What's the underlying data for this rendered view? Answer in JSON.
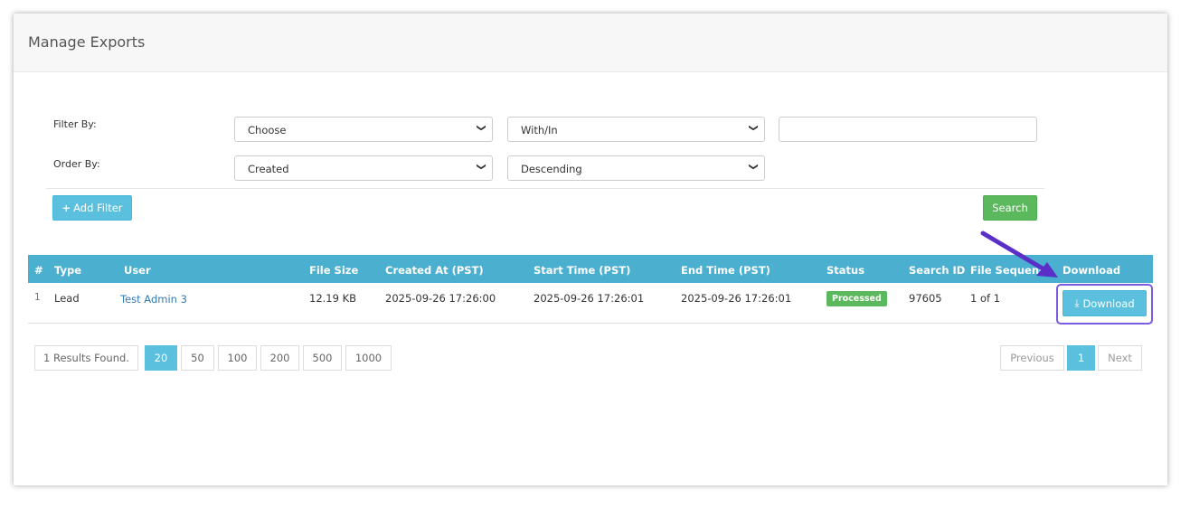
{
  "page": {
    "title": "Manage Exports"
  },
  "filters": {
    "filter_by_label": "Filter By:",
    "order_by_label": "Order By:",
    "filter_field": "Choose",
    "filter_operator": "With/In",
    "filter_value": "",
    "order_field": "Created",
    "order_direction": "Descending",
    "add_filter_label": "Add Filter",
    "search_label": "Search"
  },
  "table": {
    "headers": [
      "#",
      "Type",
      "User",
      "File Size",
      "Created At (PST)",
      "Start Time (PST)",
      "End Time (PST)",
      "Status",
      "Search ID",
      "File Sequence",
      "Download"
    ],
    "rows": [
      {
        "num": "1",
        "type": "Lead",
        "user": "Test Admin 3",
        "file_size": "12.19 KB",
        "created": "2025-09-26 17:26:00",
        "start": "2025-09-26 17:26:01",
        "end": "2025-09-26 17:26:01",
        "status": "Processed",
        "search_id": "97605",
        "sequence": "1 of 1",
        "download": "Download"
      }
    ]
  },
  "pagination": {
    "results": "1 Results Found.",
    "page_sizes": [
      "20",
      "50",
      "100",
      "200",
      "500",
      "1000"
    ],
    "selected_size": "20",
    "previous": "Previous",
    "current": "1",
    "next": "Next"
  },
  "colors": {
    "header": "#4bafd0",
    "info": "#5bc0de",
    "success": "#5cb85c",
    "link": "#337ab7",
    "highlight": "#7b5ce0"
  }
}
